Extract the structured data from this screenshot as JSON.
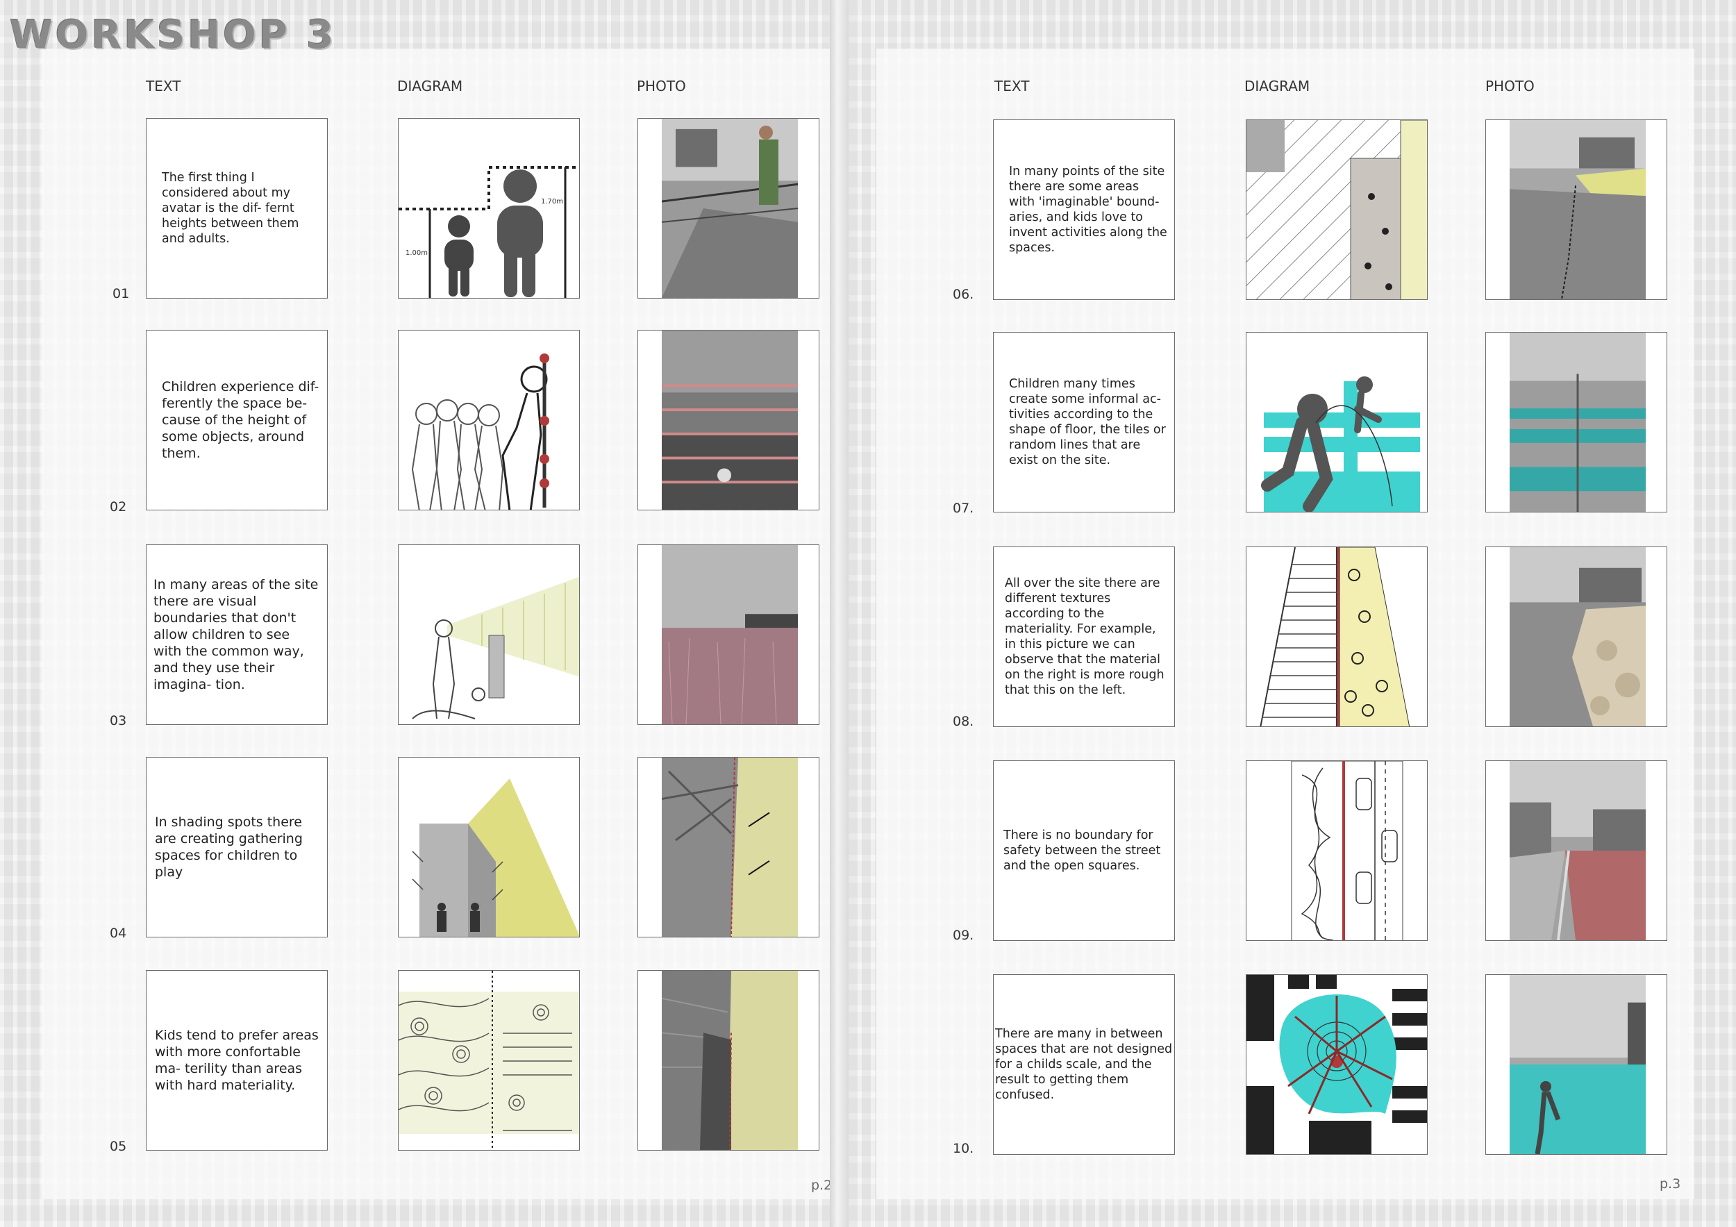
{
  "title": "WORKSHOP 3",
  "left_page": {
    "headers": {
      "text": "TEXT",
      "diagram": "DIAGRAM",
      "photo": "PHOTO"
    },
    "rows": [
      {
        "num": "01",
        "text": "The first thing I considered about my avatar is the dif- fernt heights between them and adults.",
        "labels": {
          "child_height": "1.00m",
          "adult_height": "1.70m"
        }
      },
      {
        "num": "02",
        "text": "Children experience dif- ferently the space be- cause of the height of some objects, around them."
      },
      {
        "num": "03",
        "text": "In many areas of the site there are visual boundaries that don't allow children to see with the common way, and they use their imagina- tion."
      },
      {
        "num": "04",
        "text": "In shading spots there are creating gathering spaces for children to play"
      },
      {
        "num": "05",
        "text": "Kids tend to prefer areas with more confortable ma- terility than areas with hard materiality."
      }
    ],
    "page_number": "p.2"
  },
  "right_page": {
    "headers": {
      "text": "TEXT",
      "diagram": "DIAGRAM",
      "photo": "PHOTO"
    },
    "rows": [
      {
        "num": "06.",
        "text": "In many points of the site there are some areas with 'imaginable' bound- aries, and kids love to invent activities along the spaces."
      },
      {
        "num": "07.",
        "text": "Children many times create some informal ac- tivities according to the shape of floor, the tiles or random lines that are exist on the site."
      },
      {
        "num": "08.",
        "text": "All over the site there are different textures according to the materiality. For example, in this picture we can observe that the material on the right is more rough that this on the left."
      },
      {
        "num": "09.",
        "text": "There is no boundary for safety between the street and the open squares."
      },
      {
        "num": "10.",
        "text": "There are many in between spaces that are not designed for a childs scale, and the result to getting them confused."
      }
    ],
    "page_number": "p.3"
  },
  "colors": {
    "yellow": "#e2e29a",
    "teal": "#3fd2cf",
    "red": "#b03a3a",
    "pink": "#b07a88"
  }
}
